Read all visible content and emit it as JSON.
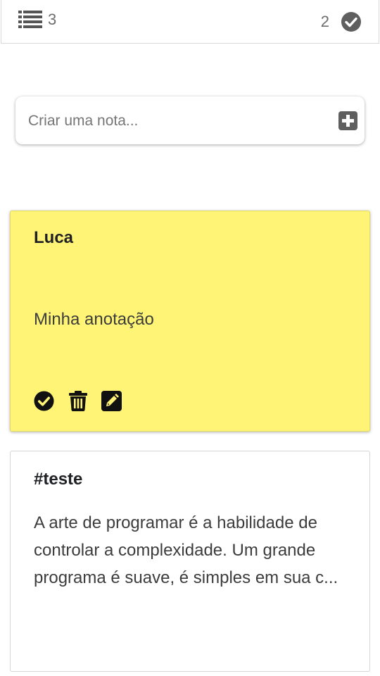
{
  "header": {
    "notes_count": "3",
    "done_count": "2",
    "list_icon": "list-icon",
    "check_icon": "check-circle-icon"
  },
  "create": {
    "placeholder": "Criar uma nota...",
    "add_icon": "plus-square-icon"
  },
  "notes": [
    {
      "title": "Luca",
      "body": "Minha anotação",
      "color": "#fff475",
      "actions": [
        "check-circle-icon",
        "trash-icon",
        "edit-icon"
      ]
    },
    {
      "title": "#teste",
      "body": "A arte de programar é a habilidade de controlar a complexidade. Um grande programa é suave, é simples em sua c...",
      "color": "#ffffff"
    }
  ]
}
